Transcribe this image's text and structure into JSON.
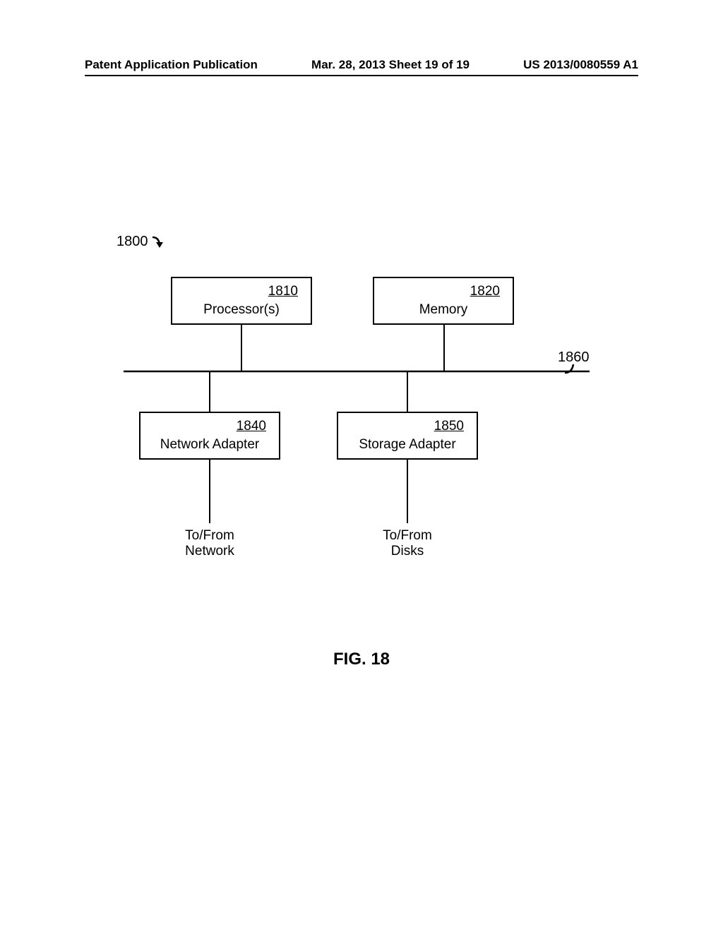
{
  "header": {
    "left": "Patent Application Publication",
    "center": "Mar. 28, 2013  Sheet 19 of 19",
    "right": "US 2013/0080559 A1"
  },
  "refs": {
    "system": "1800",
    "processor": "1810",
    "memory": "1820",
    "network_adapter": "1840",
    "storage_adapter": "1850",
    "bus": "1860"
  },
  "labels": {
    "processor": "Processor(s)",
    "memory": "Memory",
    "network_adapter": "Network Adapter",
    "storage_adapter": "Storage Adapter",
    "to_from_network_1": "To/From",
    "to_from_network_2": "Network",
    "to_from_disks_1": "To/From",
    "to_from_disks_2": "Disks"
  },
  "caption": "FIG. 18"
}
